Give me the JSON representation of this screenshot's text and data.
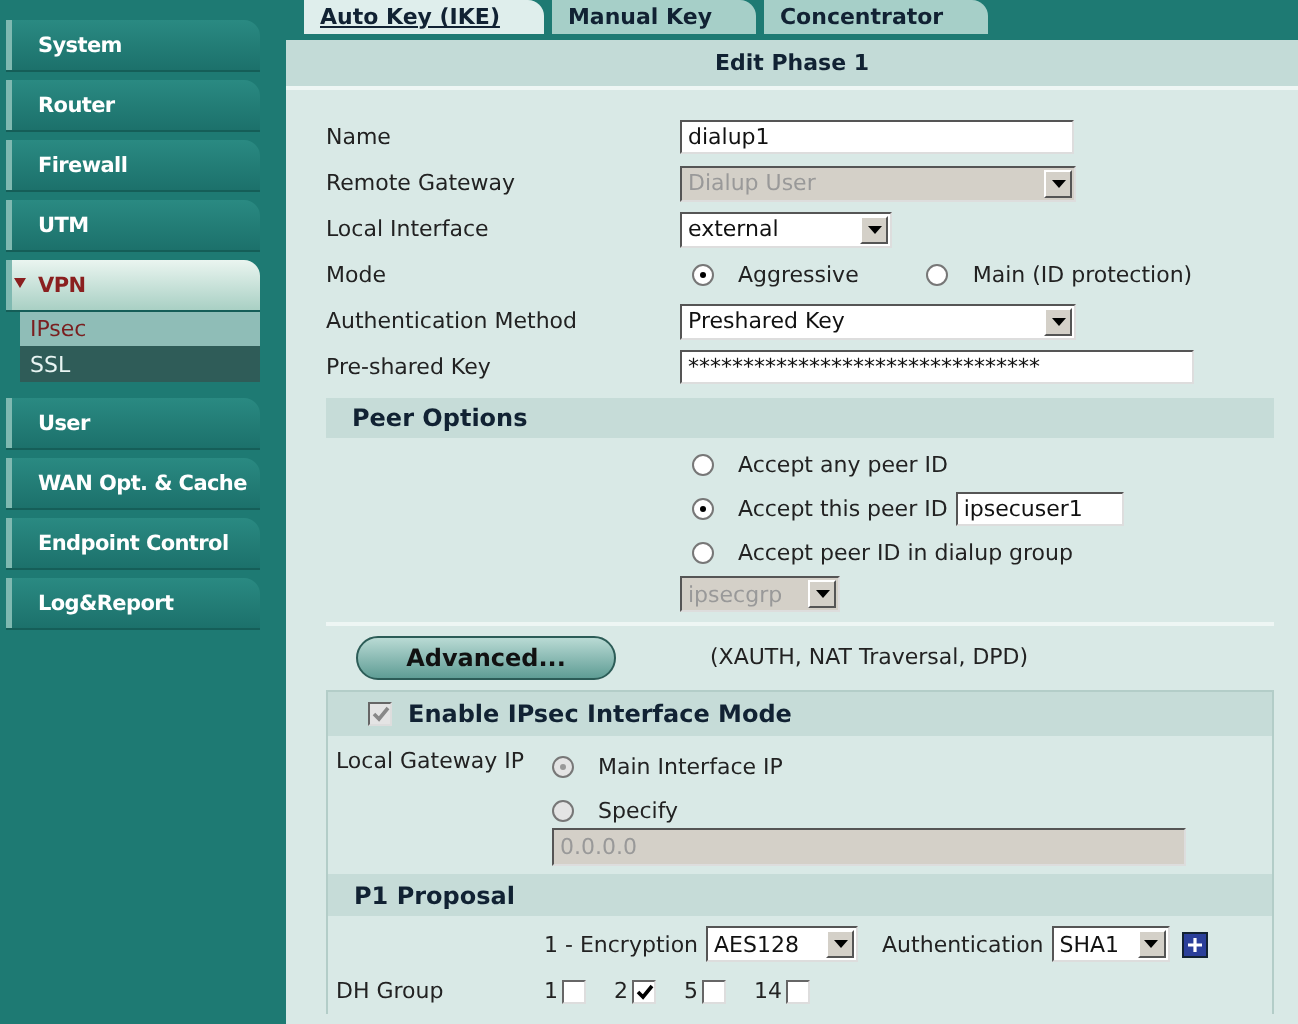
{
  "sidebar": {
    "items": [
      {
        "label": "System",
        "expanded": false
      },
      {
        "label": "Router",
        "expanded": false
      },
      {
        "label": "Firewall",
        "expanded": false
      },
      {
        "label": "UTM",
        "expanded": false
      },
      {
        "label": "VPN",
        "expanded": true,
        "children": [
          {
            "label": "IPsec",
            "selected": true
          },
          {
            "label": "SSL",
            "selected": false
          }
        ]
      },
      {
        "label": "User",
        "expanded": false
      },
      {
        "label": "WAN Opt. & Cache",
        "expanded": false
      },
      {
        "label": "Endpoint Control",
        "expanded": false
      },
      {
        "label": "Log&Report",
        "expanded": false
      }
    ]
  },
  "tabs": [
    {
      "label": "Auto Key (IKE)",
      "selected": true
    },
    {
      "label": "Manual Key",
      "selected": false
    },
    {
      "label": "Concentrator",
      "selected": false
    }
  ],
  "title": "Edit Phase 1",
  "fields": [
    {
      "label": "Name",
      "kind": "text",
      "value": "dialup1",
      "wide": false
    },
    {
      "label": "Remote Gateway",
      "kind": "select",
      "value": "Dialup User",
      "disabled": true,
      "wide": true
    },
    {
      "label": "Local Interface",
      "kind": "select",
      "value": "external",
      "disabled": false,
      "wide": false
    },
    {
      "label": "Mode",
      "kind": "radio",
      "options": [
        {
          "label": "Aggressive",
          "selected": true
        },
        {
          "label": "Main (ID protection)",
          "selected": false
        }
      ]
    },
    {
      "label": "Authentication Method",
      "kind": "select",
      "value": "Preshared Key",
      "disabled": false,
      "wide": true
    },
    {
      "label": "Pre-shared Key",
      "kind": "text",
      "value": "********************************",
      "wide": true
    }
  ],
  "peer_options": {
    "title": "Peer Options",
    "options": [
      {
        "label": "Accept any peer ID",
        "selected": false
      },
      {
        "label": "Accept this peer ID",
        "selected": true,
        "value": "ipsecuser1"
      },
      {
        "label": "Accept peer ID in dialup group",
        "selected": false
      }
    ],
    "group_select": {
      "value": "ipsecgrp",
      "disabled": true
    }
  },
  "advanced": {
    "button": "Advanced...",
    "note": "(XAUTH, NAT Traversal, DPD)"
  },
  "interface_mode": {
    "label": "Enable IPsec Interface Mode",
    "checked": true,
    "disabled": true
  },
  "local_gateway": {
    "label": "Local Gateway IP",
    "disabled": true,
    "options": [
      {
        "label": "Main Interface IP",
        "selected": true
      },
      {
        "label": "Specify",
        "selected": false
      }
    ],
    "value": "0.0.0.0"
  },
  "p1_proposal": {
    "title": "P1 Proposal",
    "encryption_label": "1 - Encryption",
    "encryption": "AES128",
    "authentication_label": "Authentication",
    "authentication": "SHA1",
    "dh_label": "DH Group",
    "dh_groups": [
      {
        "label": "1",
        "checked": false
      },
      {
        "label": "2",
        "checked": true
      },
      {
        "label": "5",
        "checked": false
      },
      {
        "label": "14",
        "checked": false
      }
    ]
  }
}
